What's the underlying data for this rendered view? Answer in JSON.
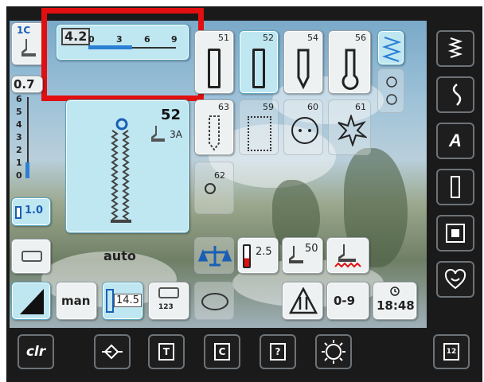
{
  "stitch_width": {
    "value": "4.2",
    "scale": [
      "0",
      "3",
      "6",
      "9"
    ]
  },
  "stitch_length": {
    "value": "0.7",
    "scale": [
      "6",
      "5",
      "4",
      "3",
      "2",
      "1",
      "0"
    ]
  },
  "presser_foot": {
    "label": "1C"
  },
  "selected_stitch": {
    "number": "52",
    "foot": "3A"
  },
  "stitch_tiles": [
    "51",
    "52",
    "54",
    "56",
    "63",
    "59",
    "60",
    "61",
    "62"
  ],
  "needle_position": {
    "value": "1.0"
  },
  "buttonhole": {
    "mode": "auto"
  },
  "needle_stop": {
    "value": "2.5"
  },
  "foot_pressure": {
    "value": "50"
  },
  "tension": {
    "value": "14.5"
  },
  "counter_label": "123",
  "manual": {
    "label": "man"
  },
  "memory": {
    "label": "0-9"
  },
  "clock": {
    "time": "18:48"
  },
  "bottom_bar": {
    "clr": "clr",
    "arrow": "→",
    "t": "T",
    "c": "C",
    "help": "?",
    "eco": "eco",
    "page": "12"
  },
  "colors": {
    "accent": "#5aa7bf",
    "selected": "#bfe7f2",
    "highlight": "#e10f0f",
    "frame": "#1a1a1a"
  }
}
